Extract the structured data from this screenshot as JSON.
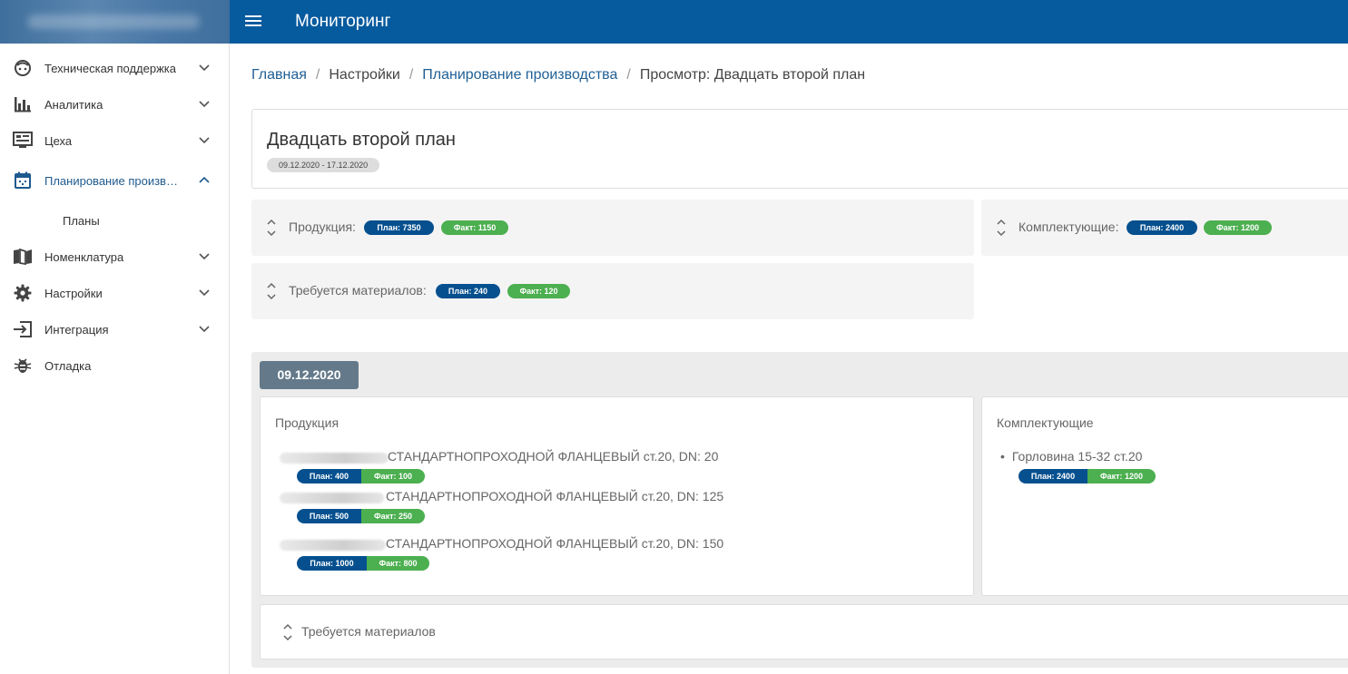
{
  "app": {
    "title": "Мониторинг"
  },
  "colors": {
    "topbar": "#065a9e",
    "plan": "#06508f",
    "fact": "#4caf50",
    "date_badge": "#647a8a"
  },
  "sidebar": {
    "items": [
      {
        "label": "Техническая поддержка",
        "icon": "support-face-icon"
      },
      {
        "label": "Аналитика",
        "icon": "bar-chart-icon"
      },
      {
        "label": "Цеха",
        "icon": "monitor-icon"
      },
      {
        "label": "Планирование произв…",
        "icon": "calendar-icon",
        "active": true
      },
      {
        "label": "Номенклатура",
        "icon": "book-map-icon"
      },
      {
        "label": "Настройки",
        "icon": "gear-icon"
      },
      {
        "label": "Интеграция",
        "icon": "login-arrow-icon"
      },
      {
        "label": "Отладка",
        "icon": "bug-icon"
      }
    ],
    "subitems": [
      {
        "label": "Планы"
      }
    ]
  },
  "breadcrumb": {
    "home": "Главная",
    "settings": "Настройки",
    "planning": "Планирование производства",
    "current": "Просмотр: Двадцать второй план"
  },
  "plan": {
    "title": "Двадцать второй план",
    "period": "09.12.2020 - 17.12.2020"
  },
  "summary": {
    "products": {
      "label": "Продукция:",
      "plan": "План: 7350",
      "fact": "Факт: 1150"
    },
    "components": {
      "label": "Комплектующие:",
      "plan": "План: 2400",
      "fact": "Факт: 1200"
    },
    "materials": {
      "label": "Требуется материалов:",
      "plan": "План: 240",
      "fact": "Факт: 120"
    }
  },
  "day": {
    "date": "09.12.2020",
    "products_title": "Продукция",
    "products": [
      {
        "name": "СТАНДАРТНОПРОХОДНОЙ ФЛАНЦЕВЫЙ ст.20, DN: 20",
        "plan": "План: 400",
        "fact": "Факт: 100"
      },
      {
        "name": "СТАНДАРТНОПРОХОДНОЙ ФЛАНЦЕВЫЙ ст.20, DN: 125",
        "plan": "План: 500",
        "fact": "Факт: 250"
      },
      {
        "name": "СТАНДАРТНОПРОХОДНОЙ ФЛАНЦЕВЫЙ ст.20, DN: 150",
        "plan": "План: 1000",
        "fact": "Факт: 800"
      }
    ],
    "components_title": "Комплектующие",
    "components": [
      {
        "name": "Горловина 15-32 ст.20",
        "plan": "План: 2400",
        "fact": "Факт: 1200"
      }
    ],
    "materials_title": "Требуется материалов"
  }
}
